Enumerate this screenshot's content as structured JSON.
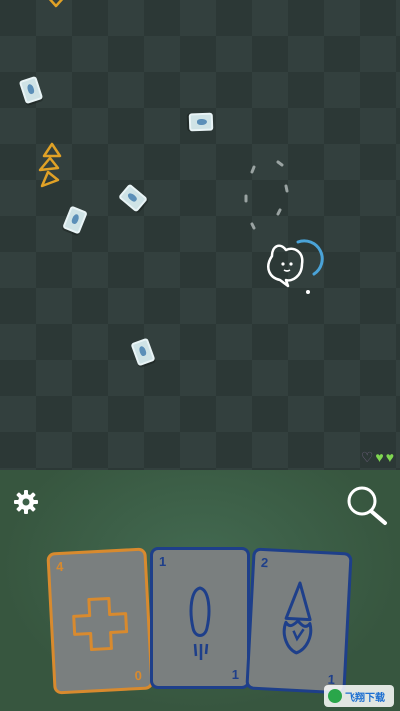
{
  "arena": {
    "colors": {
      "tile_dark": "#2c3836",
      "tile_light": "#33403e"
    }
  },
  "player": {
    "icon": "ghost-icon",
    "color": "#ffffff",
    "cooldown_color": "#4aa3d8"
  },
  "lives": {
    "total": 3,
    "filled": 2,
    "empty_color": "#7b6a8d",
    "full_color": "#7fd651"
  },
  "toolbar": {
    "settings_icon": "gear-icon",
    "zoom_icon": "magnifier-icon"
  },
  "hand": {
    "cards": [
      {
        "cost": "4",
        "corner": "0",
        "art": "plus-icon",
        "color": "#d88a2e"
      },
      {
        "cost": "1",
        "corner": "1",
        "art": "fireball-icon",
        "color": "#1e3f8a"
      },
      {
        "cost": "2",
        "corner": "1",
        "art": "flame-spike-icon",
        "color": "#1e3f8a"
      }
    ]
  },
  "watermark": {
    "text": "飞翔下载"
  }
}
